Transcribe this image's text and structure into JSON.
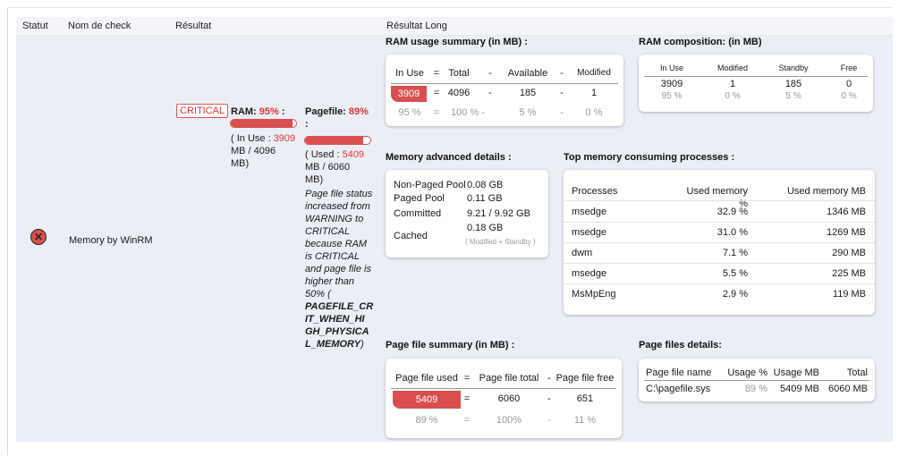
{
  "header": {
    "statut": "Statut",
    "nom": "Nom de check",
    "resultat": "Résultat",
    "long": "Résultat Long"
  },
  "check": {
    "name": "Memory by WinRM",
    "status_icon": "critical-x-icon",
    "badge": "CRITICAL",
    "ram_label": "RAM: ",
    "ram_pct": "95%",
    "ram_colon": " :",
    "ram_fill": 0.95,
    "ram_detail_pre": "( In Use : ",
    "ram_inuse": "3909",
    "ram_detail_line2": "MB / 4096",
    "ram_detail_line3": "MB)",
    "pf_label": "Pagefile: ",
    "pf_pct": "89%",
    "pf_colon": ":",
    "pf_fill": 0.89,
    "pf_detail_pre": "( Used : ",
    "pf_used": "5409",
    "pf_detail_line2": "MB / 6060",
    "pf_detail_line3": "MB)",
    "pf_note_lines": [
      "Page file status",
      "increased from",
      "WARNING to",
      "CRITICAL",
      "because RAM",
      "is CRITICAL",
      "and page file is",
      "higher than",
      "50% ("
    ],
    "pf_const_lines": [
      "PAGEFILE_CR",
      "IT_WHEN_HI",
      "GH_PHYSICA",
      "L_MEMORY"
    ],
    "pf_close": ")"
  },
  "ram_usage": {
    "title": "RAM usage summary (in MB) :",
    "h": [
      "In Use",
      "=",
      "Total",
      "-",
      "Available",
      "-",
      "Modified"
    ],
    "v": [
      "3909",
      "=",
      "4096",
      "-",
      "185",
      "-",
      "1"
    ],
    "p": [
      "95 %",
      "=",
      "100 % -",
      "",
      "5 %",
      "-",
      "0 %"
    ]
  },
  "ram_comp": {
    "title": "RAM composition: (in MB)",
    "h": [
      "In Use",
      "Modified",
      "Standby",
      "Free"
    ],
    "v": [
      "3909",
      "1",
      "185",
      "0"
    ],
    "p": [
      "95 %",
      "0 %",
      "5 %",
      "0 %"
    ]
  },
  "mem_adv": {
    "title": "Memory advanced details :",
    "rows": [
      {
        "k": "Non-Paged Pool",
        "v": "0.08 GB"
      },
      {
        "k": "Paged Pool",
        "v": "0.11 GB"
      },
      {
        "k": "Committed",
        "v": "9.21 / 9.92 GB"
      },
      {
        "k": "Cached",
        "v": "0.18 GB",
        "sub": "( Modified + Standby )"
      }
    ]
  },
  "top_proc": {
    "title": "Top memory consuming processes :",
    "h": [
      "Processes",
      "Used memory %",
      "Used memory MB"
    ],
    "rows": [
      [
        "msedge",
        "32.9 %",
        "1346 MB"
      ],
      [
        "msedge",
        "31.0 %",
        "1269 MB"
      ],
      [
        "dwm",
        "7.1 %",
        "290 MB"
      ],
      [
        "msedge",
        "5.5 %",
        "225 MB"
      ],
      [
        "MsMpEng",
        "2.9 %",
        "119 MB"
      ]
    ]
  },
  "pf_summary": {
    "title": "Page file summary (in MB) :",
    "h": [
      "Page file used",
      "=",
      "Page file total",
      "-",
      "Page file free"
    ],
    "v": [
      "5409",
      "=",
      "6060",
      "-",
      "651"
    ],
    "p": [
      "89 %",
      "=",
      "100%",
      "-",
      "11 %"
    ]
  },
  "pf_details": {
    "title": "Page files details:",
    "h": [
      "Page file name",
      "Usage %",
      "Usage MB",
      "Total"
    ],
    "row": [
      "C:\\pagefile.sys",
      "89 %",
      "5409 MB",
      "6060 MB"
    ]
  },
  "colors": {
    "critical": "#d94f4f",
    "row_bg": "#eceef6"
  }
}
